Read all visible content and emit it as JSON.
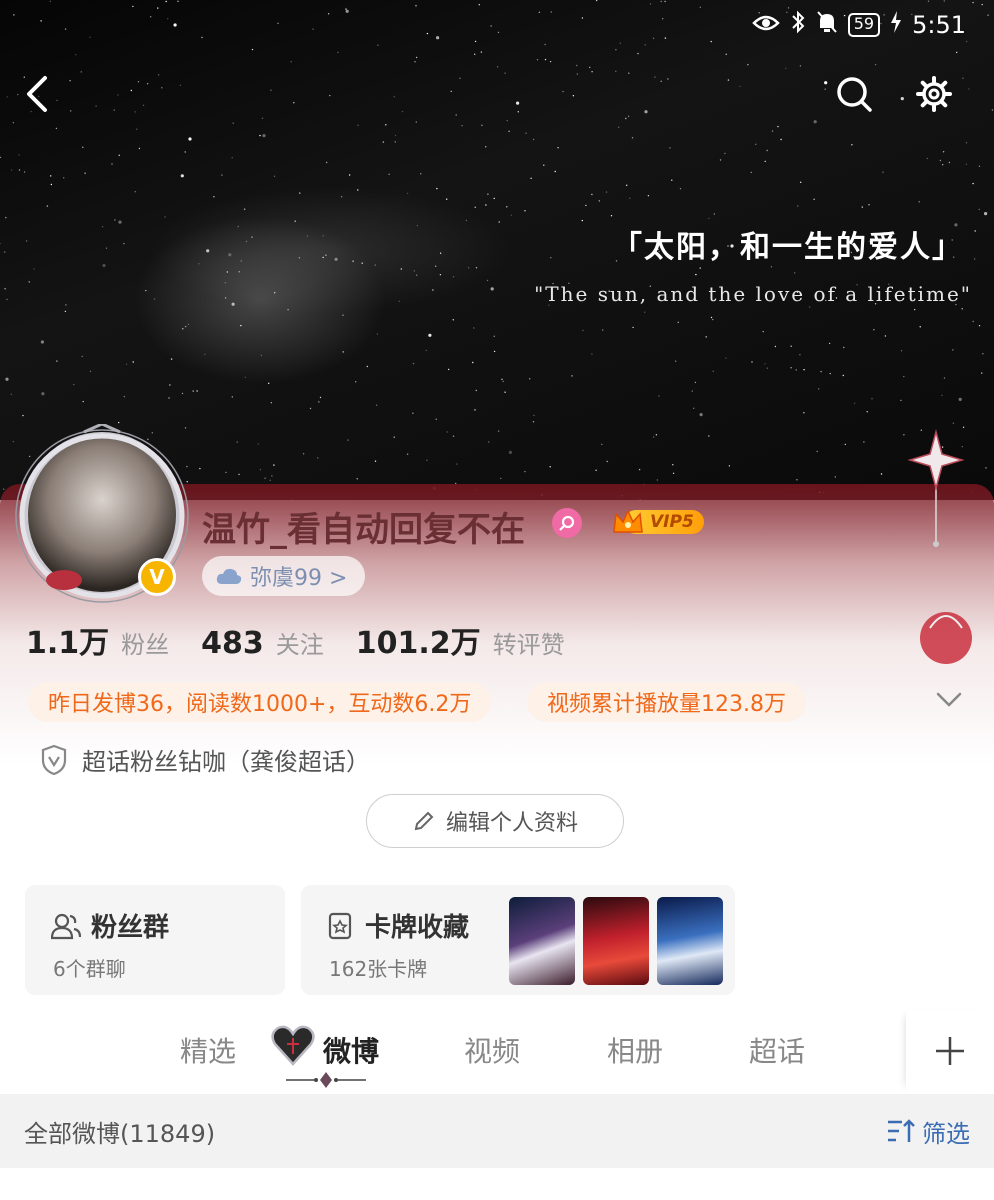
{
  "status_bar": {
    "battery": "59",
    "time": "5:51"
  },
  "banner": {
    "quote_cn": "「太阳，和一生的爱人」",
    "quote_en": "\"The sun, and the love of a lifetime\""
  },
  "profile": {
    "username": "温竹_看自动回复不在",
    "vip_label": "VIP5",
    "verified_badge": "V",
    "alias": "弥虞99 >",
    "stats": {
      "fans_value": "1.1万",
      "fans_label": "粉丝",
      "following_value": "483",
      "following_label": "关注",
      "likes_value": "101.2万",
      "likes_label": "转评赞"
    },
    "info_tags": [
      "昨日发博36，阅读数1000+，互动数6.2万",
      "视频累计播放量123.8万"
    ],
    "supertopic": "超话粉丝钻咖（龚俊超话）",
    "edit_button": "编辑个人资料"
  },
  "cards": {
    "fan_group": {
      "title": "粉丝群",
      "subtitle": "6个群聊"
    },
    "card_collection": {
      "title": "卡牌收藏",
      "subtitle": "162张卡牌"
    }
  },
  "tabs": [
    "精选",
    "微博",
    "视频",
    "相册",
    "超话"
  ],
  "active_tab": "微博",
  "filter": {
    "left": "全部微博(11849)",
    "right": "筛选"
  },
  "colors": {
    "accent_orange": "#f0681a",
    "link_blue": "#3b6db3",
    "vip_gold": "#ffcc33",
    "verified_gold": "#f7b500"
  }
}
